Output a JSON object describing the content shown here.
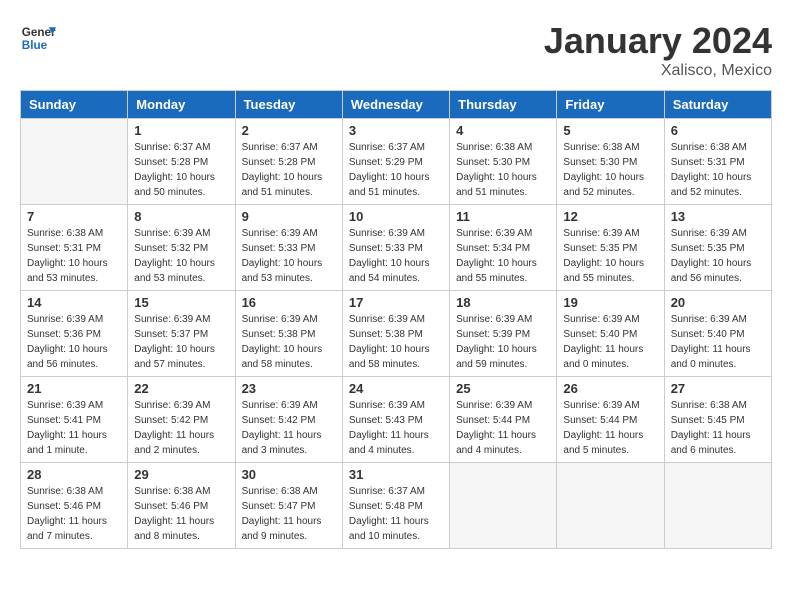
{
  "header": {
    "logo_line1": "General",
    "logo_line2": "Blue",
    "month": "January 2024",
    "location": "Xalisco, Mexico"
  },
  "weekdays": [
    "Sunday",
    "Monday",
    "Tuesday",
    "Wednesday",
    "Thursday",
    "Friday",
    "Saturday"
  ],
  "weeks": [
    [
      {
        "day": "",
        "sunrise": "",
        "sunset": "",
        "daylight": "",
        "empty": true
      },
      {
        "day": "1",
        "sunrise": "Sunrise: 6:37 AM",
        "sunset": "Sunset: 5:28 PM",
        "daylight": "Daylight: 10 hours and 50 minutes."
      },
      {
        "day": "2",
        "sunrise": "Sunrise: 6:37 AM",
        "sunset": "Sunset: 5:28 PM",
        "daylight": "Daylight: 10 hours and 51 minutes."
      },
      {
        "day": "3",
        "sunrise": "Sunrise: 6:37 AM",
        "sunset": "Sunset: 5:29 PM",
        "daylight": "Daylight: 10 hours and 51 minutes."
      },
      {
        "day": "4",
        "sunrise": "Sunrise: 6:38 AM",
        "sunset": "Sunset: 5:30 PM",
        "daylight": "Daylight: 10 hours and 51 minutes."
      },
      {
        "day": "5",
        "sunrise": "Sunrise: 6:38 AM",
        "sunset": "Sunset: 5:30 PM",
        "daylight": "Daylight: 10 hours and 52 minutes."
      },
      {
        "day": "6",
        "sunrise": "Sunrise: 6:38 AM",
        "sunset": "Sunset: 5:31 PM",
        "daylight": "Daylight: 10 hours and 52 minutes."
      }
    ],
    [
      {
        "day": "7",
        "sunrise": "Sunrise: 6:38 AM",
        "sunset": "Sunset: 5:31 PM",
        "daylight": "Daylight: 10 hours and 53 minutes."
      },
      {
        "day": "8",
        "sunrise": "Sunrise: 6:39 AM",
        "sunset": "Sunset: 5:32 PM",
        "daylight": "Daylight: 10 hours and 53 minutes."
      },
      {
        "day": "9",
        "sunrise": "Sunrise: 6:39 AM",
        "sunset": "Sunset: 5:33 PM",
        "daylight": "Daylight: 10 hours and 53 minutes."
      },
      {
        "day": "10",
        "sunrise": "Sunrise: 6:39 AM",
        "sunset": "Sunset: 5:33 PM",
        "daylight": "Daylight: 10 hours and 54 minutes."
      },
      {
        "day": "11",
        "sunrise": "Sunrise: 6:39 AM",
        "sunset": "Sunset: 5:34 PM",
        "daylight": "Daylight: 10 hours and 55 minutes."
      },
      {
        "day": "12",
        "sunrise": "Sunrise: 6:39 AM",
        "sunset": "Sunset: 5:35 PM",
        "daylight": "Daylight: 10 hours and 55 minutes."
      },
      {
        "day": "13",
        "sunrise": "Sunrise: 6:39 AM",
        "sunset": "Sunset: 5:35 PM",
        "daylight": "Daylight: 10 hours and 56 minutes."
      }
    ],
    [
      {
        "day": "14",
        "sunrise": "Sunrise: 6:39 AM",
        "sunset": "Sunset: 5:36 PM",
        "daylight": "Daylight: 10 hours and 56 minutes."
      },
      {
        "day": "15",
        "sunrise": "Sunrise: 6:39 AM",
        "sunset": "Sunset: 5:37 PM",
        "daylight": "Daylight: 10 hours and 57 minutes."
      },
      {
        "day": "16",
        "sunrise": "Sunrise: 6:39 AM",
        "sunset": "Sunset: 5:38 PM",
        "daylight": "Daylight: 10 hours and 58 minutes."
      },
      {
        "day": "17",
        "sunrise": "Sunrise: 6:39 AM",
        "sunset": "Sunset: 5:38 PM",
        "daylight": "Daylight: 10 hours and 58 minutes."
      },
      {
        "day": "18",
        "sunrise": "Sunrise: 6:39 AM",
        "sunset": "Sunset: 5:39 PM",
        "daylight": "Daylight: 10 hours and 59 minutes."
      },
      {
        "day": "19",
        "sunrise": "Sunrise: 6:39 AM",
        "sunset": "Sunset: 5:40 PM",
        "daylight": "Daylight: 11 hours and 0 minutes."
      },
      {
        "day": "20",
        "sunrise": "Sunrise: 6:39 AM",
        "sunset": "Sunset: 5:40 PM",
        "daylight": "Daylight: 11 hours and 0 minutes."
      }
    ],
    [
      {
        "day": "21",
        "sunrise": "Sunrise: 6:39 AM",
        "sunset": "Sunset: 5:41 PM",
        "daylight": "Daylight: 11 hours and 1 minute."
      },
      {
        "day": "22",
        "sunrise": "Sunrise: 6:39 AM",
        "sunset": "Sunset: 5:42 PM",
        "daylight": "Daylight: 11 hours and 2 minutes."
      },
      {
        "day": "23",
        "sunrise": "Sunrise: 6:39 AM",
        "sunset": "Sunset: 5:42 PM",
        "daylight": "Daylight: 11 hours and 3 minutes."
      },
      {
        "day": "24",
        "sunrise": "Sunrise: 6:39 AM",
        "sunset": "Sunset: 5:43 PM",
        "daylight": "Daylight: 11 hours and 4 minutes."
      },
      {
        "day": "25",
        "sunrise": "Sunrise: 6:39 AM",
        "sunset": "Sunset: 5:44 PM",
        "daylight": "Daylight: 11 hours and 4 minutes."
      },
      {
        "day": "26",
        "sunrise": "Sunrise: 6:39 AM",
        "sunset": "Sunset: 5:44 PM",
        "daylight": "Daylight: 11 hours and 5 minutes."
      },
      {
        "day": "27",
        "sunrise": "Sunrise: 6:38 AM",
        "sunset": "Sunset: 5:45 PM",
        "daylight": "Daylight: 11 hours and 6 minutes."
      }
    ],
    [
      {
        "day": "28",
        "sunrise": "Sunrise: 6:38 AM",
        "sunset": "Sunset: 5:46 PM",
        "daylight": "Daylight: 11 hours and 7 minutes."
      },
      {
        "day": "29",
        "sunrise": "Sunrise: 6:38 AM",
        "sunset": "Sunset: 5:46 PM",
        "daylight": "Daylight: 11 hours and 8 minutes."
      },
      {
        "day": "30",
        "sunrise": "Sunrise: 6:38 AM",
        "sunset": "Sunset: 5:47 PM",
        "daylight": "Daylight: 11 hours and 9 minutes."
      },
      {
        "day": "31",
        "sunrise": "Sunrise: 6:37 AM",
        "sunset": "Sunset: 5:48 PM",
        "daylight": "Daylight: 11 hours and 10 minutes."
      },
      {
        "day": "",
        "sunrise": "",
        "sunset": "",
        "daylight": "",
        "empty": true
      },
      {
        "day": "",
        "sunrise": "",
        "sunset": "",
        "daylight": "",
        "empty": true
      },
      {
        "day": "",
        "sunrise": "",
        "sunset": "",
        "daylight": "",
        "empty": true
      }
    ]
  ]
}
